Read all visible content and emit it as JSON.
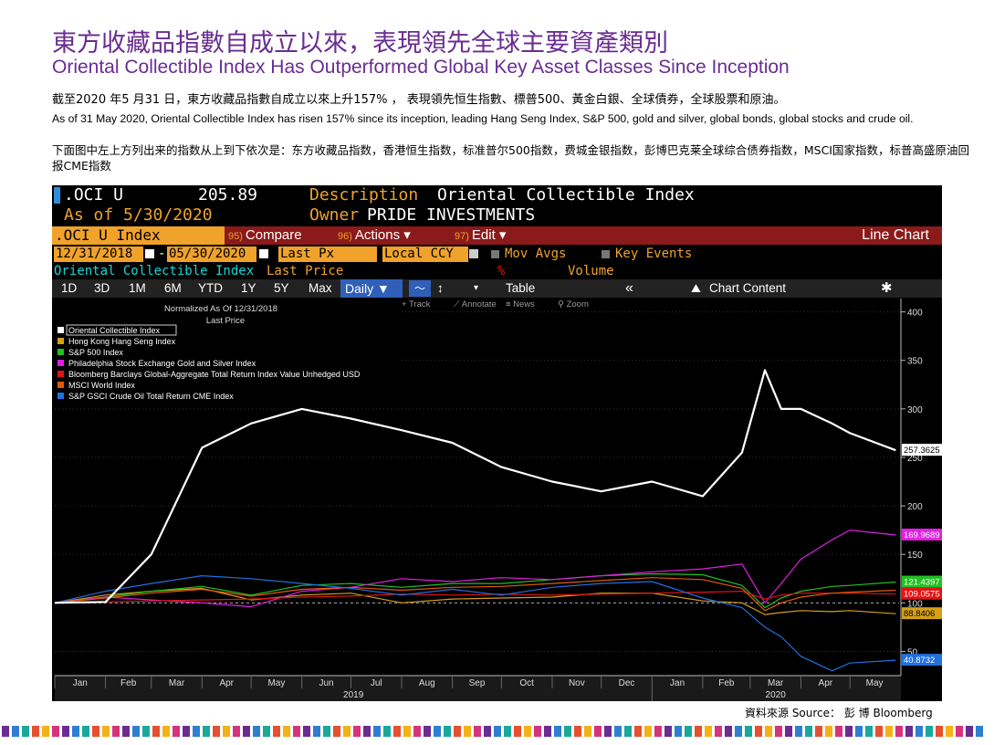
{
  "header": {
    "title_zh": "東方收藏品指數自成立以來，表現領先全球主要資產類別",
    "title_en": "Oriental Collectible Index Has Outperformed Global Key Asset Classes Since Inception",
    "desc_zh": "截至2020 年5 月31 日，東方收藏品指數自成立以來上升157% ， 表現領先恒生指數、標普500、黃金白銀、全球債券，全球股票和原油。",
    "desc_en": "As of 31 May 2020, Oriental Collectible Index has risen 157% since its inception, leading Hang Seng Index, S&P 500, gold and silver, global bonds, global stocks and crude oil.",
    "desc_zh2": "下面图中左上方列出来的指数从上到下依次是：东方收藏品指数，香港恒生指数，标准普尔500指数，费城金银指数，彭博巴克莱全球综合债券指数，MSCI国家指数，标普高盛原油回报CME指数"
  },
  "terminal": {
    "ticker": ".OCI U",
    "price": "205.89",
    "desc_label": "Description",
    "desc_value": "Oriental Collectible Index",
    "as_of": "As of 5/30/2020",
    "owner_label": "Owner",
    "owner_value": "PRIDE INVESTMENTS",
    "security": ".OCI U Index",
    "btn_compare_num": "95)",
    "btn_compare": "Compare",
    "btn_actions_num": "96)",
    "btn_actions": "Actions ▾",
    "btn_edit_num": "97)",
    "btn_edit": "Edit ▾",
    "chart_kind": "Line Chart",
    "start_date": "12/31/2018",
    "end_date": "05/30/2020",
    "field": "Last Px",
    "currency": "Local CCY",
    "mov_avgs": "Mov Avgs",
    "key_events": "Key Events",
    "series_label": "Oriental Collectible Index",
    "last_price_label": "Last Price",
    "pct": "%",
    "volume_label": "Volume",
    "periods": [
      "1D",
      "3D",
      "1M",
      "6M",
      "YTD",
      "1Y",
      "5Y",
      "Max"
    ],
    "daily": "Daily ▼",
    "table": "Table",
    "collapse": "«",
    "chart_content": "Chart Content",
    "tools": [
      "+ Track",
      "⟋ Annotate",
      "≡ News",
      "⚲ Zoom"
    ]
  },
  "chart_data": {
    "type": "line",
    "legend_title_1": "Normalized As Of 12/31/2018",
    "legend_title_2": "Last Price",
    "ylim": [
      25,
      410
    ],
    "y_ticks": [
      "50",
      "100",
      "150",
      "200",
      "250",
      "300",
      "350",
      "400"
    ],
    "x_month_labels": [
      "Jan",
      "Feb",
      "Mar",
      "Apr",
      "May",
      "Jun",
      "Jul",
      "Aug",
      "Sep",
      "Oct",
      "Nov",
      "Dec",
      "Jan",
      "Feb",
      "Mar",
      "Apr",
      "May"
    ],
    "x_year_labels": [
      "2019",
      "2020"
    ],
    "x": [
      "2019-01-01",
      "2019-02-01",
      "2019-03-01",
      "2019-04-01",
      "2019-05-01",
      "2019-06-01",
      "2019-07-01",
      "2019-08-01",
      "2019-09-01",
      "2019-10-01",
      "2019-11-01",
      "2019-12-01",
      "2020-01-01",
      "2020-02-01",
      "2020-02-25",
      "2020-03-10",
      "2020-03-20",
      "2020-04-01",
      "2020-04-20",
      "2020-05-01",
      "2020-05-29"
    ],
    "series": [
      {
        "name": "Oriental Collectible Index",
        "color": "#ffffff",
        "last_label": "257.3625",
        "values": [
          100,
          101,
          150,
          260,
          285,
          300,
          290,
          278,
          265,
          240,
          225,
          215,
          225,
          210,
          255,
          340,
          300,
          300,
          285,
          275,
          257.36
        ]
      },
      {
        "name": "Hong Kong Hang Seng Index",
        "color": "#d4a017",
        "last_label": "88.8406",
        "values": [
          100,
          108,
          112,
          115,
          103,
          108,
          110,
          100,
          104,
          105,
          106,
          110,
          110,
          102,
          100,
          88,
          90,
          92,
          91,
          92,
          88.84
        ]
      },
      {
        "name": "S&P 500 Index",
        "color": "#22c022",
        "last_label": "121.4397",
        "values": [
          100,
          106,
          112,
          117,
          108,
          118,
          120,
          116,
          120,
          120,
          124,
          128,
          130,
          129,
          118,
          95,
          105,
          112,
          117,
          118,
          121.44
        ]
      },
      {
        "name": "Philadelphia Stock Exchange Gold and Silver Index",
        "color": "#e020e0",
        "last_label": "169.9689",
        "values": [
          100,
          106,
          103,
          100,
          96,
          112,
          116,
          125,
          122,
          126,
          124,
          128,
          132,
          135,
          140,
          100,
          120,
          145,
          165,
          175,
          169.97
        ]
      },
      {
        "name": "Bloomberg Barclays Global-Aggregate Total Return Index Value Unhedged USD",
        "color": "#e01414",
        "last_label": "109.0575",
        "values": [
          100,
          101,
          102,
          103,
          104,
          106,
          107,
          109,
          108,
          109,
          108,
          109,
          110,
          111,
          112,
          104,
          108,
          110,
          110,
          110,
          109.06
        ]
      },
      {
        "name": "MSCI World Index",
        "color": "#e05a0a",
        "last_label": "",
        "values": [
          100,
          105,
          110,
          114,
          107,
          114,
          116,
          113,
          116,
          117,
          120,
          123,
          126,
          124,
          115,
          92,
          100,
          106,
          110,
          111,
          113
        ]
      },
      {
        "name": "S&P GSCI Crude Oil Total Return CME Index",
        "color": "#2070e0",
        "last_label": "40.8732",
        "values": [
          100,
          112,
          120,
          128,
          125,
          120,
          115,
          108,
          114,
          108,
          116,
          120,
          122,
          105,
          95,
          75,
          65,
          45,
          30,
          38,
          40.87
        ]
      }
    ]
  },
  "footer": {
    "source": "資料來源 Source： 彭 博 Bloomberg"
  },
  "strip_colors": [
    "#6a2c91",
    "#2e7fd1",
    "#1aa89b",
    "#e6502e",
    "#f2b218",
    "#d6337c"
  ]
}
